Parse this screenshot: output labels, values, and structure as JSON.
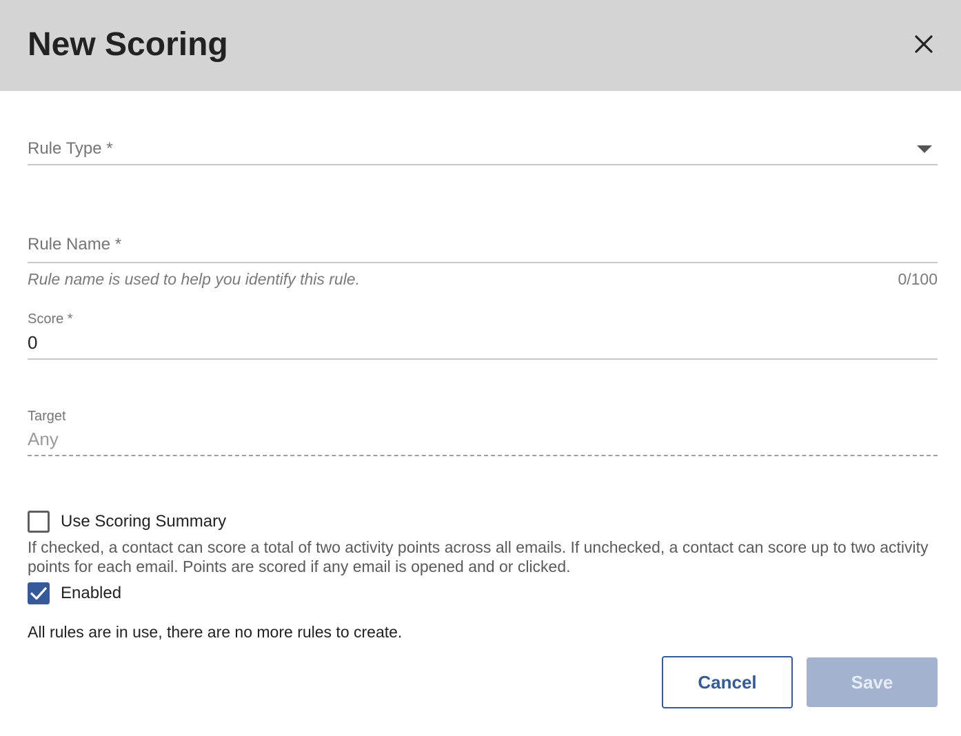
{
  "dialog": {
    "title": "New Scoring",
    "close_icon": "close-icon"
  },
  "rule_type": {
    "label": "Rule Type *",
    "value": "",
    "icon": "dropdown-arrow-icon"
  },
  "rule_name": {
    "label": "Rule Name *",
    "value": "",
    "hint": "Rule name is used to help you identify this rule.",
    "counter": "0/100"
  },
  "score": {
    "label": "Score *",
    "value": "0"
  },
  "target": {
    "label": "Target",
    "value": "Any",
    "disabled": true
  },
  "use_scoring_summary": {
    "label": "Use Scoring Summary",
    "checked": false,
    "description": "If checked, a contact can score a total of two activity points across all emails. If unchecked, a contact can score up to two activity points for each email. Points are scored if any email is opened and or clicked."
  },
  "enabled": {
    "label": "Enabled",
    "checked": true
  },
  "notice": "All rules are in use, there are no more rules to create.",
  "buttons": {
    "cancel_label": "Cancel",
    "save_label": "Save",
    "save_disabled": true
  },
  "colors": {
    "header_bg": "#d4d4d4",
    "accent": "#355a9a",
    "save_disabled_bg": "#a3b3cf"
  }
}
